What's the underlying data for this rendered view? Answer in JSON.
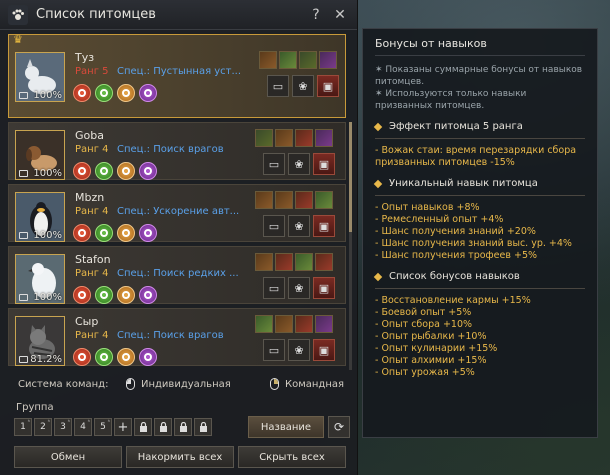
{
  "window": {
    "title": "Список питомцев",
    "help_label": "?",
    "close_label": "✕"
  },
  "pets": [
    {
      "name": "Туз",
      "rank": "Ранг 5",
      "spec": "Спец.: Пустынная уст...",
      "hunger": "100%",
      "animal": "wolf",
      "talents": [
        "tal-a",
        "tal-b",
        "tal-e",
        "tal-d"
      ]
    },
    {
      "name": "Goba",
      "rank": "Ранг 4",
      "spec": "Спец.: Поиск врагов",
      "hunger": "100%",
      "animal": "dog",
      "talents": [
        "tal-e",
        "tal-a",
        "tal-c",
        "tal-d"
      ]
    },
    {
      "name": "Mbzn",
      "rank": "Ранг 4",
      "spec": "Спец.: Ускорение авт...",
      "hunger": "100%",
      "animal": "penguin",
      "talents": [
        "tal-a",
        "tal-a",
        "tal-c",
        "tal-b"
      ]
    },
    {
      "name": "Stafon",
      "rank": "Ранг 4",
      "spec": "Спец.: Поиск редких ...",
      "hunger": "100%",
      "animal": "bird",
      "talents": [
        "tal-a",
        "tal-c",
        "tal-b",
        "tal-c"
      ]
    },
    {
      "name": "Сыр",
      "rank": "Ранг 4",
      "spec": "Спец.: Поиск врагов",
      "hunger": "81.2%",
      "animal": "cat",
      "talents": [
        "tal-b",
        "tal-a",
        "tal-c",
        "tal-d"
      ]
    }
  ],
  "command": {
    "label": "Система команд:",
    "individual": "Индивидуальная",
    "team": "Командная"
  },
  "group": {
    "label": "Группа",
    "slots": [
      "1",
      "2",
      "3",
      "4",
      "5"
    ],
    "name_button": "Название"
  },
  "bottom": {
    "exchange": "Обмен",
    "feed_all": "Накормить всех",
    "hide_all": "Скрыть всех"
  },
  "bonus": {
    "title": "Бонусы от навыков",
    "note1": "✶ Показаны суммарные бонусы от навыков питомцев.",
    "note2": "✶ Используются только навыки призванных питомцев.",
    "section1": "Эффект питомца 5 ранга",
    "section1_lines": [
      "- Вожак стаи: время перезарядки сбора призванных питомцев -15%"
    ],
    "section2": "Уникальный навык питомца",
    "section2_lines": [
      "- Опыт навыков +8%",
      "- Ремесленный опыт +4%",
      "- Шанс получения знаний +20%",
      "- Шанс получения знаний выс. ур. +4%",
      "- Шанс получения трофеев +5%"
    ],
    "section3": "Список бонусов навыков",
    "section3_lines": [
      "- Восстановление кармы +15%",
      "- Боевой опыт +5%",
      "- Опыт сбора +10%",
      "- Опыт рыбалки +10%",
      "- Опыт кулинарии +15%",
      "- Опыт алхимии +15%",
      "- Опыт урожая +5%"
    ]
  }
}
